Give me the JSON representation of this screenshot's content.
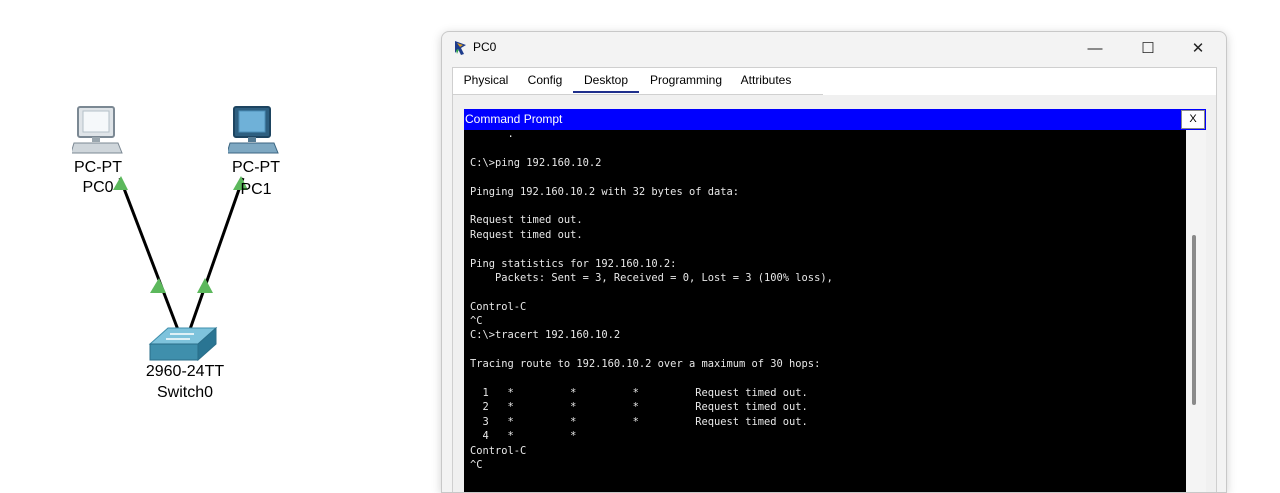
{
  "topology": {
    "devices": [
      {
        "type_label": "PC-PT",
        "name": "PC0"
      },
      {
        "type_label": "PC-PT",
        "name": "PC1"
      },
      {
        "type_label": "2960-24TT",
        "name": "Switch0"
      }
    ],
    "link_status_color": "#5cb85c"
  },
  "window": {
    "title": "PC0",
    "controls": {
      "minimize": "—",
      "maximize": "☐",
      "close": "✕"
    },
    "tabs": [
      "Physical",
      "Config",
      "Desktop",
      "Programming",
      "Attributes"
    ],
    "active_tab": "Desktop",
    "command_prompt": {
      "title": "Command Prompt",
      "close_label": "X",
      "title_bar_color": "#0000ff",
      "lines": [
        "      .",
        "",
        "C:\\>ping 192.160.10.2",
        "",
        "Pinging 192.160.10.2 with 32 bytes of data:",
        "",
        "Request timed out.",
        "Request timed out.",
        "",
        "Ping statistics for 192.160.10.2:",
        "    Packets: Sent = 3, Received = 0, Lost = 3 (100% loss),",
        "",
        "Control-C",
        "^C",
        "C:\\>tracert 192.160.10.2",
        "",
        "Tracing route to 192.160.10.2 over a maximum of 30 hops:",
        "",
        "  1   *         *         *         Request timed out.",
        "  2   *         *         *         Request timed out.",
        "  3   *         *         *         Request timed out.",
        "  4   *         *",
        "Control-C",
        "^C"
      ]
    }
  }
}
